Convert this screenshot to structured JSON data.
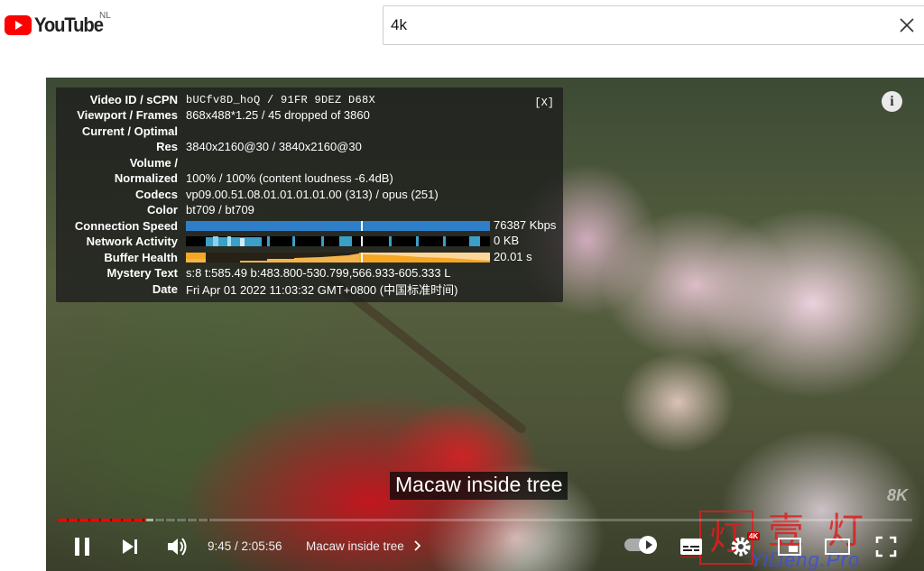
{
  "header": {
    "logo_text": "YouTube",
    "country": "NL",
    "search_value": "4k"
  },
  "stats": {
    "close_label": "[X]",
    "rows": [
      {
        "label": "Video ID / sCPN",
        "value": "bUCfv8D_hoQ / 91FR 9DEZ D68X"
      },
      {
        "label": "Viewport / Frames",
        "value": "868x488*1.25 / 45 dropped of 3860"
      },
      {
        "label": "Current / Optimal",
        "value": ""
      },
      {
        "label": "Res",
        "value": "3840x2160@30 / 3840x2160@30"
      },
      {
        "label": "Volume /",
        "value": ""
      },
      {
        "label": "Normalized",
        "value": "100% / 100% (content loudness -6.4dB)"
      },
      {
        "label": "Codecs",
        "value": "vp09.00.51.08.01.01.01.01.00 (313) / opus (251)"
      },
      {
        "label": "Color",
        "value": "bt709 / bt709"
      },
      {
        "label": "Connection Speed",
        "value": "76387 Kbps"
      },
      {
        "label": "Network Activity",
        "value": "0 KB"
      },
      {
        "label": "Buffer Health",
        "value": "20.01 s"
      },
      {
        "label": "Mystery Text",
        "value": "s:8 t:585.49 b:483.800-530.799,566.933-605.333 L"
      },
      {
        "label": "Date",
        "value": "Fri Apr 01 2022 11:03:32 GMT+0800 (中国标准时间)"
      }
    ]
  },
  "player": {
    "info_icon": "i",
    "caption": "Macaw inside tree",
    "corner_badge": "8K",
    "played_fraction": 0.103,
    "buffered_fraction": 0.112,
    "time": "9:45 / 2:05:56",
    "chapter": "Macaw inside tree",
    "quality_badge": "4K",
    "colors": {
      "played": "#ff0000",
      "stat_bar": "#2e7fc7",
      "buffer_bar": "#f5a623"
    }
  },
  "watermark": {
    "logo_char": "灯",
    "text": "壹灯",
    "url": "YiDeng.Pro"
  },
  "icons": [
    "youtube-logo-icon",
    "clear-icon",
    "info-icon",
    "pause-icon",
    "next-icon",
    "volume-icon",
    "chevron-right-icon",
    "autoplay-toggle",
    "subtitles-icon",
    "settings-icon",
    "miniplayer-icon",
    "theater-icon",
    "fullscreen-icon"
  ]
}
